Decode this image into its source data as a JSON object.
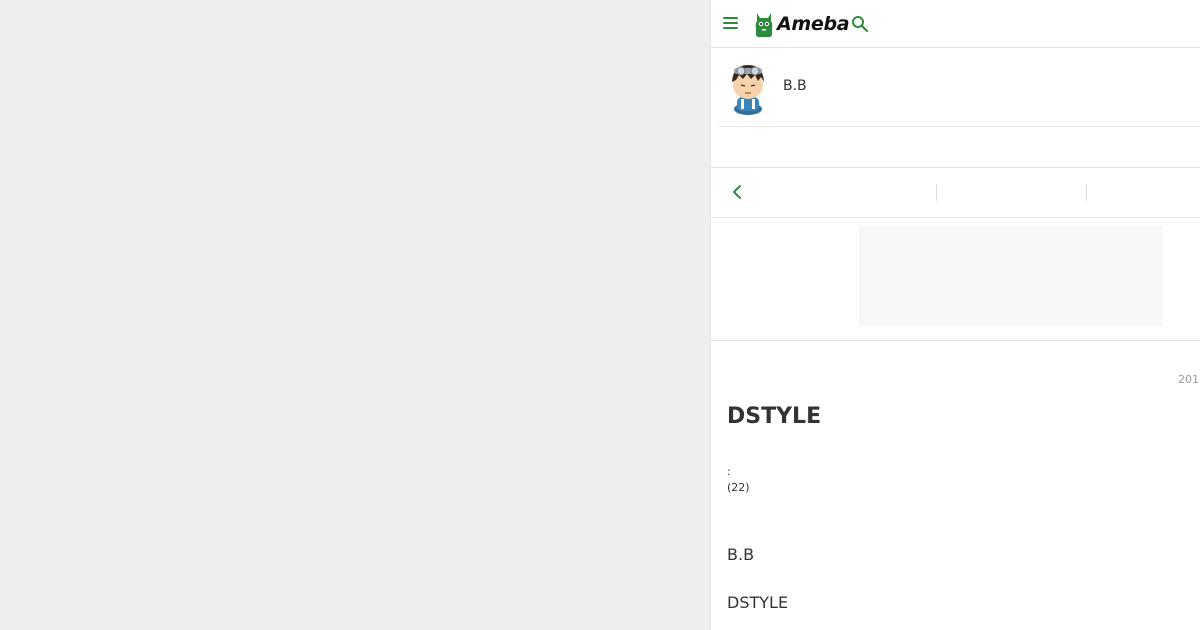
{
  "header": {
    "logo_text": "Ameba",
    "brand_color": "#2d8c3c"
  },
  "profile": {
    "name": "B.B"
  },
  "entry": {
    "date": "201",
    "title": "DSTYLE",
    "meta_line1": ":",
    "meta_line2": "(22)",
    "body_line1": "B.B",
    "body_line2": "DSTYLE"
  },
  "icons": {
    "menu": "hamburger-menu-icon",
    "search": "search-icon",
    "back": "chevron-left-icon"
  }
}
